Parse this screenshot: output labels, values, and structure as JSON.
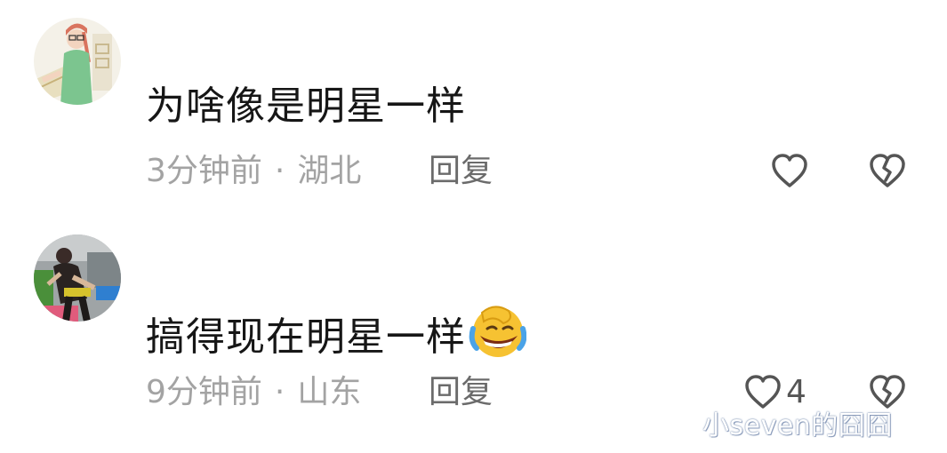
{
  "comments": [
    {
      "text": "为啥像是明星一样",
      "time": "3分钟前",
      "separator": "·",
      "location": "湖北",
      "reply_label": "回复",
      "like_count": ""
    },
    {
      "text": "搞得现在明星一样",
      "time": "9分钟前",
      "separator": "·",
      "location": "山东",
      "reply_label": "回复",
      "like_count": "4"
    }
  ],
  "icons": {
    "like": "heart-outline-icon",
    "dislike": "broken-heart-icon",
    "emoji": "rolling-laughing-emoji"
  },
  "watermark": "小seven的囧囧",
  "colors": {
    "text": "#161616",
    "meta": "#a3a3a3",
    "reply": "#6b6b6b",
    "icon": "#555555"
  }
}
